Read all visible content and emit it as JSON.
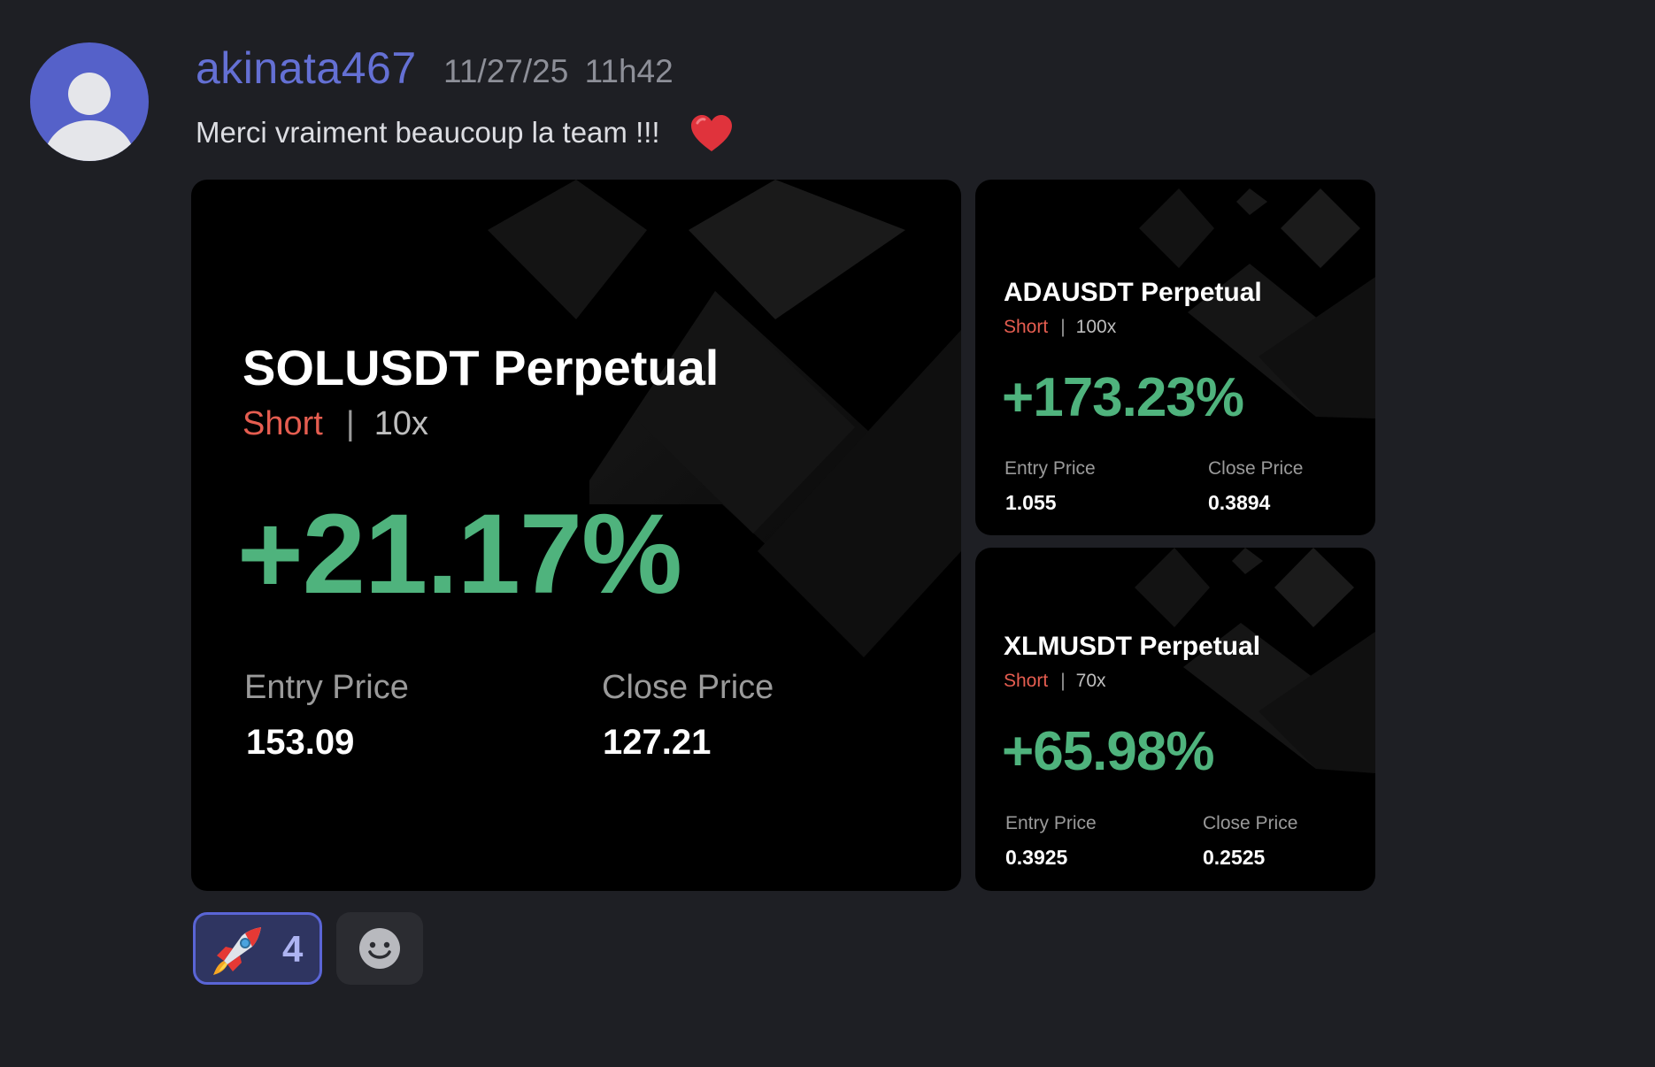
{
  "message": {
    "username": "akinata467",
    "date": "11/27/25",
    "time": "11h42",
    "text": "Merci vraiment beaucoup la team !!!",
    "emoji_icon": "red-heart-icon"
  },
  "cards": [
    {
      "pair": "SOLUSDT Perpetual",
      "side": "Short",
      "leverage": "10x",
      "pnl": "+21.17%",
      "entry_label": "Entry Price",
      "entry_value": "153.09",
      "close_label": "Close Price",
      "close_value": "127.21"
    },
    {
      "pair": "ADAUSDT Perpetual",
      "side": "Short",
      "leverage": "100x",
      "pnl": "+173.23%",
      "entry_label": "Entry Price",
      "entry_value": "1.055",
      "close_label": "Close Price",
      "close_value": "0.3894"
    },
    {
      "pair": "XLMUSDT Perpetual",
      "side": "Short",
      "leverage": "70x",
      "pnl": "+65.98%",
      "entry_label": "Entry Price",
      "entry_value": "0.3925",
      "close_label": "Close Price",
      "close_value": "0.2525"
    }
  ],
  "reactions": [
    {
      "emoji": "rocket-icon",
      "count": "4",
      "selected": true
    }
  ],
  "add_reaction": {
    "icon": "smiley-icon"
  },
  "colors": {
    "background": "#1e1f24",
    "username": "#6470d4",
    "profit": "#4fb37d",
    "short": "#e55d50",
    "reaction_border": "#5a65d6"
  }
}
